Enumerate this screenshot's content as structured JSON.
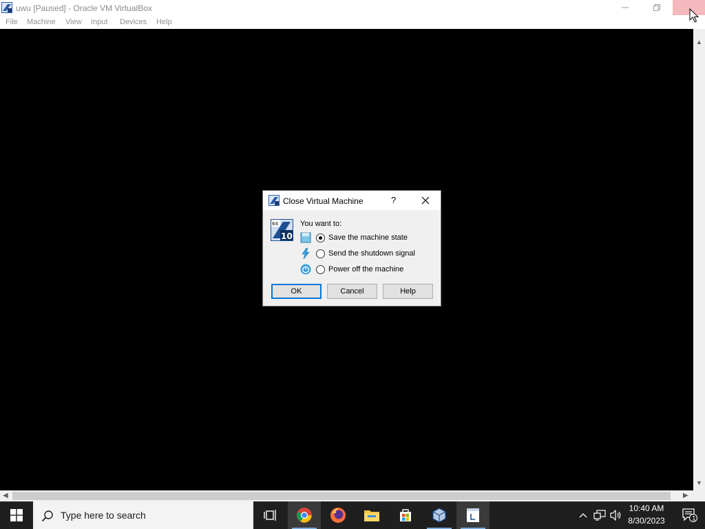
{
  "window": {
    "title": "uwu [Paused] - Oracle VM VirtualBox",
    "menu": [
      "File",
      "Machine",
      "View",
      "Input",
      "Devices",
      "Help"
    ]
  },
  "dialog": {
    "title": "Close Virtual Machine",
    "help_glyph": "?",
    "prompt": "You want to:",
    "options": [
      {
        "label": "Save the machine state",
        "checked": true,
        "icon": "save-state-icon"
      },
      {
        "label": "Send the shutdown signal",
        "checked": false,
        "icon": "shutdown-signal-icon"
      },
      {
        "label": "Power off the machine",
        "checked": false,
        "icon": "power-off-icon"
      }
    ],
    "buttons": {
      "ok": "OK",
      "cancel": "Cancel",
      "help": "Help"
    },
    "os_badge": {
      "top": "64",
      "bottom": "10"
    }
  },
  "taskbar": {
    "search_placeholder": "Type here to search",
    "apps": [
      "task-view",
      "chrome",
      "firefox",
      "file-explorer",
      "microsoft-store",
      "virtualbox",
      "virtualbox-vm"
    ],
    "clock": {
      "time": "10:40 AM",
      "date": "8/30/2023"
    },
    "notification_count": "1"
  },
  "colors": {
    "vm_background": "#000000",
    "taskbar": "#1f1f1f",
    "accent": "#0078d7",
    "close_hover": "#f4b8bd"
  }
}
